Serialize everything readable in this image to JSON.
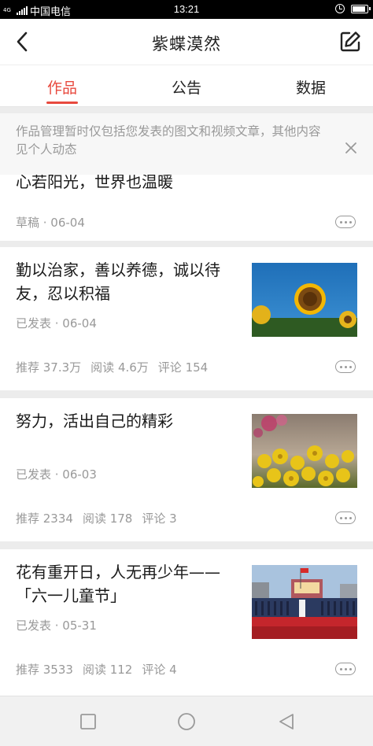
{
  "status_bar": {
    "network": "4G",
    "carrier": "中国电信",
    "time": "13:21",
    "battery_level": 0.9
  },
  "header": {
    "title": "紫蝶漠然",
    "back_icon": "chevron-left-icon",
    "edit_icon": "edit-icon"
  },
  "tabs": [
    {
      "label": "作品",
      "active": true
    },
    {
      "label": "公告",
      "active": false
    },
    {
      "label": "数据",
      "active": false
    }
  ],
  "notice": {
    "text": "作品管理暂时仅包括您发表的图文和视频文章，其他内容见个人动态",
    "close_icon": "close-icon"
  },
  "articles": [
    {
      "title": "心若阳光，世界也温暖",
      "status": "草稿 · 06-04",
      "stats": []
    },
    {
      "title": "勤以治家，善以养德，诚以待友，忍以积福",
      "status": "已发表 · 06-04",
      "stats": [
        "推荐 37.3万",
        "阅读 4.6万",
        "评论 154"
      ],
      "thumbnail": "sunflower-image"
    },
    {
      "title": "努力，活出自己的精彩",
      "status": "已发表 · 06-03",
      "stats": [
        "推荐 2334",
        "阅读 178",
        "评论 3"
      ],
      "thumbnail": "yellow-flowers-image"
    },
    {
      "title": "花有重开日，人无再少年——「六一儿童节」",
      "status": "已发表 · 05-31",
      "stats": [
        "推荐 3533",
        "阅读 112",
        "评论 4"
      ],
      "thumbnail": "childrens-day-stage-image"
    }
  ],
  "colors": {
    "accent": "#e8493e",
    "muted_text": "#999999",
    "background": "#ececec"
  }
}
